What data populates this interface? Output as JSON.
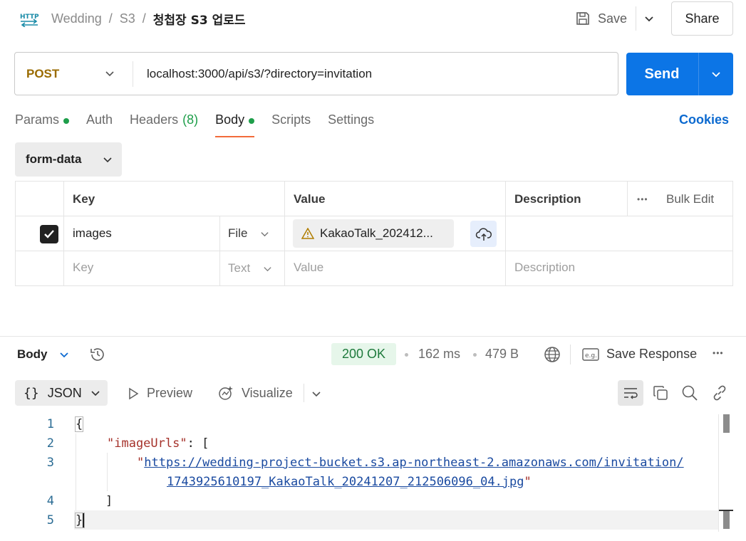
{
  "header": {
    "badge": "HTTP",
    "breadcrumb": [
      "Wedding",
      "S3"
    ],
    "request_name": "청첩장 S3 업로드",
    "save_label": "Save",
    "share_label": "Share"
  },
  "request": {
    "method": "POST",
    "url": "localhost:3000/api/s3/?directory=invitation",
    "send_label": "Send"
  },
  "tabs": {
    "params": "Params",
    "auth": "Auth",
    "headers": "Headers",
    "headers_count": "(8)",
    "body": "Body",
    "scripts": "Scripts",
    "settings": "Settings",
    "cookies": "Cookies"
  },
  "body_type": "form-data",
  "table": {
    "headers": {
      "key": "Key",
      "value": "Value",
      "description": "Description",
      "bulk_edit": "Bulk Edit"
    },
    "rows": [
      {
        "checked": true,
        "key": "images",
        "type": "File",
        "value": "KakaoTalk_202412...",
        "description": ""
      }
    ],
    "new_row": {
      "key_placeholder": "Key",
      "type": "Text",
      "value_placeholder": "Value",
      "description_placeholder": "Description"
    }
  },
  "response": {
    "body_label": "Body",
    "status": "200 OK",
    "time": "162 ms",
    "size": "479 B",
    "save_response": "Save Response",
    "format": "JSON",
    "preview": "Preview",
    "visualize": "Visualize",
    "code": {
      "line_numbers": [
        "1",
        "2",
        "3",
        "4",
        "5"
      ],
      "open_brace": "{",
      "key": "\"imageUrls\"",
      "colon_bracket": ": [",
      "quote_open": "\"",
      "url_part1": "https://wedding-project-bucket.s3.ap-northeast-2.amazonaws.com/invitation/",
      "url_part2": "1743925610197_KakaoTalk_20241207_212506096_04.jpg",
      "quote_close": "\"",
      "close_bracket": "]",
      "close_brace": "}"
    }
  },
  "colors": {
    "send": "#0c75e6",
    "method": "#9a6b00",
    "active_tab_underline": "#f26b3a",
    "status_ok": "#1e7a3c",
    "cookies": "#0c6ad0"
  }
}
